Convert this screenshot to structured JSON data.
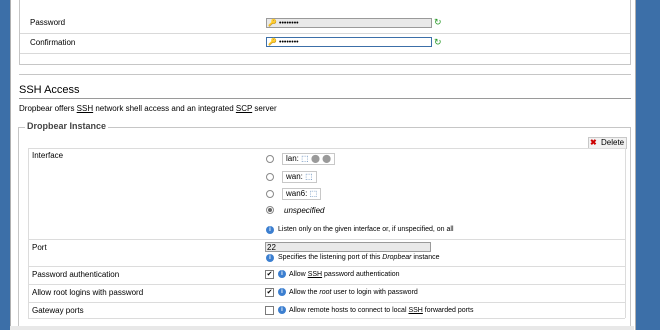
{
  "password_section": {
    "password_label": "Password",
    "password_value": "••••••••",
    "confirm_label": "Confirmation",
    "confirm_value": "••••••••"
  },
  "ssh": {
    "title": "SSH Access",
    "description_pre": "Dropbear offers ",
    "description_ssh": "SSH",
    "description_mid": " network shell access and an integrated ",
    "description_scp": "SCP",
    "description_post": " server",
    "instance_legend": "Dropbear Instance",
    "delete_label": "Delete",
    "interface": {
      "label": "Interface",
      "options": [
        {
          "name": "lan:",
          "selected": false
        },
        {
          "name": "wan:",
          "selected": false
        },
        {
          "name": "wan6:",
          "selected": false
        }
      ],
      "unspecified_label": "unspecified",
      "hint": "Listen only on the given interface or, if unspecified, on all"
    },
    "port": {
      "label": "Port",
      "value": "22",
      "hint_pre": "Specifies the listening port of this ",
      "hint_em": "Dropbear",
      "hint_post": " instance"
    },
    "password_auth": {
      "label": "Password authentication",
      "checked": true,
      "hint_pre": "Allow ",
      "hint_ssh": "SSH",
      "hint_post": " password authentication"
    },
    "root_login": {
      "label": "Allow root logins with password",
      "checked": true,
      "hint_pre": "Allow the ",
      "hint_em": "root",
      "hint_post": " user to login with password"
    },
    "gateway_ports": {
      "label": "Gateway ports",
      "checked": false,
      "hint_pre": "Allow remote hosts to connect to local ",
      "hint_ssh": "SSH",
      "hint_post": " forwarded ports"
    }
  },
  "icons": {
    "key": "key-icon",
    "refresh": "refresh-icon",
    "network": "network-icon",
    "info": "info-icon",
    "delete": "delete-icon"
  },
  "colors": {
    "background": "#3c6fa8",
    "info_blue": "#3c7fd0",
    "refresh_green": "#2a9a2a",
    "delete_red": "#cc0000"
  }
}
